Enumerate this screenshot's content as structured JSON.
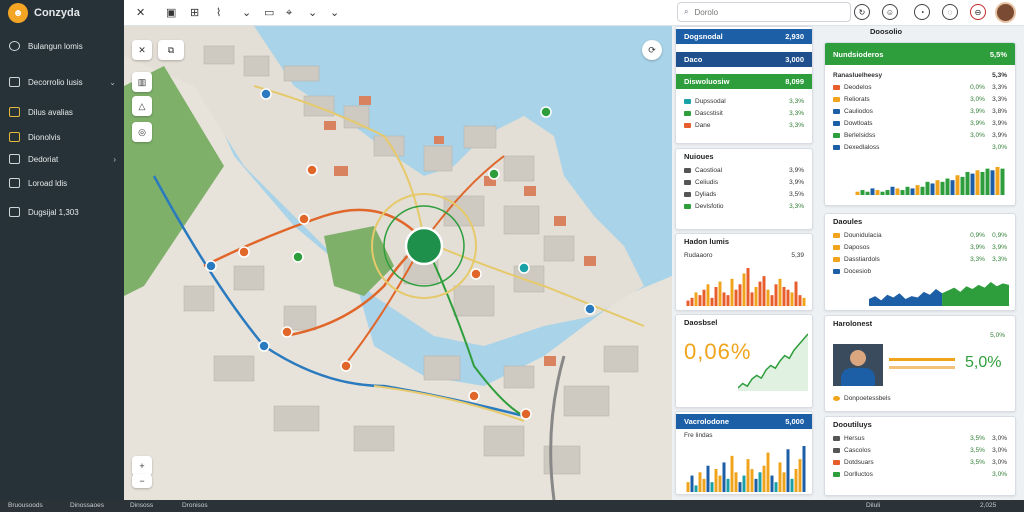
{
  "app": {
    "name": "Conzyda"
  },
  "sidebar": {
    "items": [
      {
        "label": "Bulangun lomis",
        "icon": "globe-icon"
      },
      {
        "label": "Decorrolio lusis",
        "icon": "layers-icon"
      },
      {
        "label": "Dilus avalias",
        "icon": "grid-icon"
      },
      {
        "label": "Dionolvis",
        "icon": "chart-icon"
      },
      {
        "label": "Dedoriat",
        "icon": "list-icon"
      },
      {
        "label": "Loroad ldis",
        "icon": "report-icon"
      },
      {
        "label": "Dugsijal 1,303",
        "icon": "table-icon"
      }
    ]
  },
  "search": {
    "placeholder": "Dorolo"
  },
  "panels": {
    "p1": {
      "header_label": "Dogsnodal",
      "header_value": "2,930",
      "sub_label": "Daco",
      "sub_value": "3,000",
      "green_label": "Diswoluosiw",
      "green_value": "8,099",
      "rows": [
        {
          "label": "Dupssodal",
          "value": "3,3%",
          "color": "#1aa1a8"
        },
        {
          "label": "Dascstisit",
          "value": "3,3%",
          "color": "#2e9e3c"
        },
        {
          "label": "Dane",
          "value": "3,3%",
          "color": "#e85d2c"
        }
      ]
    },
    "p2": {
      "title": "Nuioues",
      "rows": [
        {
          "label": "Caostioal",
          "value": "3,9%"
        },
        {
          "label": "Celiudis",
          "value": "3,9%"
        },
        {
          "label": "Dyliads",
          "value": "3,5%"
        },
        {
          "label": "Devlsfotio",
          "value": "3,3%"
        }
      ]
    },
    "p3": {
      "title": "Hadon lumis",
      "sub": "Rudaaoro",
      "sub_value": "5,39"
    },
    "p4": {
      "title": "Daosbsel",
      "big": "0,06%"
    },
    "p5": {
      "header_label": "Vacrolodone",
      "header_value": "5,000",
      "sub_label": "Fre lindas"
    },
    "c1": {
      "header_label": "Nundsioderos",
      "header_value": "5,5%",
      "title": "Ranasluelheesy",
      "title_value": "5,3%",
      "rows": [
        {
          "label": "Deodelos",
          "v1": "0,0%",
          "v2": "3,3%",
          "color": "#e85d2c"
        },
        {
          "label": "Reliorats",
          "v1": "3,0%",
          "v2": "3,3%",
          "color": "#f0a41c"
        },
        {
          "label": "Cauliodos",
          "v1": "3,9%",
          "v2": "3,8%",
          "color": "#1d5fa6"
        },
        {
          "label": "Dowtloats",
          "v1": "3,9%",
          "v2": "3,9%",
          "color": "#1d5fa6"
        },
        {
          "label": "Berlelsidss",
          "v1": "3,0%",
          "v2": "3,9%",
          "color": "#2e9e3c"
        },
        {
          "label": "Dexedlaloss",
          "v1": "3,0%",
          "v2": "",
          "color": "#1d5fa6"
        }
      ]
    },
    "c2": {
      "title": "Daoules",
      "rows": [
        {
          "label": "Dounidulacia",
          "v1": "0,9%",
          "v2": "0,9%",
          "color": "#f0a41c"
        },
        {
          "label": "Daposos",
          "v1": "3,9%",
          "v2": "3,9%",
          "color": "#f0a41c"
        },
        {
          "label": "Dasstiardols",
          "v1": "3,3%",
          "v2": "3,3%",
          "color": "#f0a41c"
        },
        {
          "label": "Docesiob",
          "v1": "",
          "v2": "",
          "color": "#1d5fa6"
        }
      ]
    },
    "c3": {
      "title": "Harolonest",
      "sub_value": "5,0%",
      "big": "5,0%",
      "footer": "Donpoetessbels"
    },
    "c4": {
      "title": "Dooutiluys",
      "rows": [
        {
          "label": "Hersus",
          "v1": "3,5%",
          "v2": "3,0%"
        },
        {
          "label": "Cascolos",
          "v1": "3,5%",
          "v2": "3,0%"
        },
        {
          "label": "Dotdsuars",
          "v1": "3,5%",
          "v2": "3,0%"
        },
        {
          "label": "Dorlluctos",
          "v1": "3,0%",
          "v2": ""
        }
      ]
    },
    "right_header": "Doosolio"
  },
  "statusbar": {
    "items": [
      "Bruousoods",
      "Dinossaoes",
      "Dinsoss",
      "Dronisos",
      "Diluli",
      "2,025"
    ]
  },
  "chart_data": [
    {
      "type": "bar",
      "title": "Hadon lumis",
      "values": [
        2,
        3,
        5,
        4,
        6,
        8,
        3,
        7,
        9,
        5,
        4,
        10,
        6,
        8,
        12,
        14,
        5,
        7,
        9,
        11,
        6,
        4,
        8,
        10,
        7,
        6,
        5,
        9,
        4,
        3
      ]
    },
    {
      "type": "line",
      "title": "Daosbsel",
      "values": [
        2,
        2.5,
        2.2,
        3,
        3.4,
        3.1,
        4,
        4.5,
        4.2,
        5,
        5.6,
        5.3,
        6.2,
        6.8,
        7.4,
        8
      ]
    },
    {
      "type": "bar",
      "title": "Fre lindas",
      "values": [
        3,
        5,
        2,
        6,
        4,
        8,
        3,
        7,
        5,
        9,
        4,
        11,
        6,
        3,
        5,
        10,
        7,
        4,
        6,
        8,
        12,
        5,
        3,
        9,
        6,
        13,
        4,
        7,
        10,
        14
      ]
    },
    {
      "type": "bar",
      "title": "Ranasluelheesy",
      "values": [
        2,
        3,
        2,
        4,
        3,
        2,
        3,
        5,
        4,
        3,
        5,
        4,
        6,
        5,
        8,
        7,
        9,
        8,
        10,
        9,
        12,
        11,
        14,
        13,
        15,
        14,
        16,
        15,
        17,
        16
      ]
    },
    {
      "type": "area",
      "title": "Daoules",
      "values": [
        5,
        7,
        4,
        8,
        6,
        9,
        5,
        7,
        6,
        10,
        8,
        12,
        9,
        11,
        13,
        10,
        14,
        12,
        15,
        13,
        17,
        14,
        16,
        15
      ]
    }
  ]
}
